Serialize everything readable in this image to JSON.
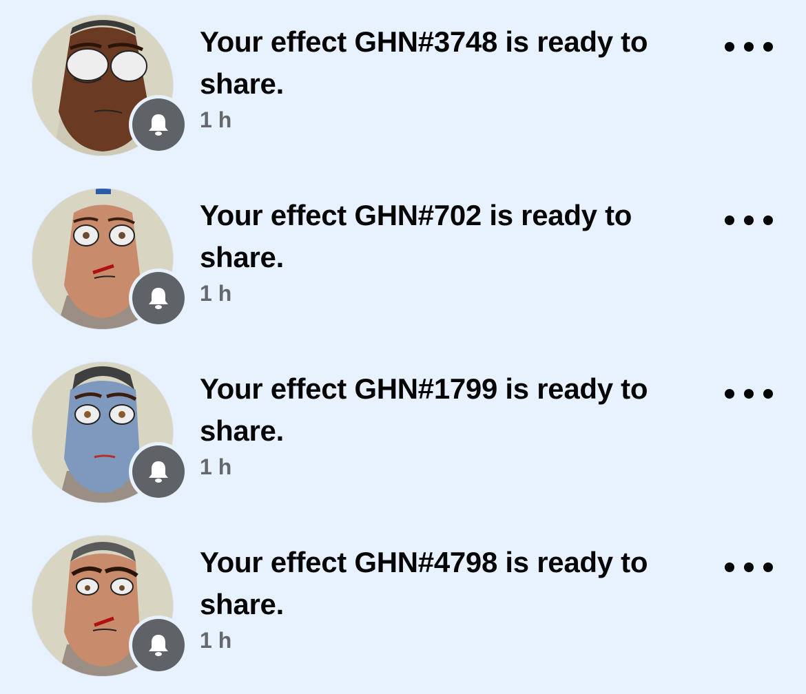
{
  "notifications": [
    {
      "title": "Your effect GHN#3748 is ready to share.",
      "time": "1 h",
      "avatar_icon": "face-effect-avatar",
      "badge_icon": "bell-icon",
      "face_color": "#6b3a22"
    },
    {
      "title": "Your effect GHN#702 is ready to share.",
      "time": "1 h",
      "avatar_icon": "face-effect-avatar",
      "badge_icon": "bell-icon",
      "face_color": "#c88b6b"
    },
    {
      "title": "Your effect GHN#1799 is ready to share.",
      "time": "1 h",
      "avatar_icon": "face-effect-avatar",
      "badge_icon": "bell-icon",
      "face_color": "#7f98bd"
    },
    {
      "title": "Your effect GHN#4798 is ready to share.",
      "time": "1 h",
      "avatar_icon": "face-effect-avatar",
      "badge_icon": "bell-icon",
      "face_color": "#c88b6b"
    }
  ],
  "colors": {
    "background": "#e7f2fe",
    "badge": "#5f6368",
    "title_text": "#050505",
    "time_text": "#65676b"
  }
}
